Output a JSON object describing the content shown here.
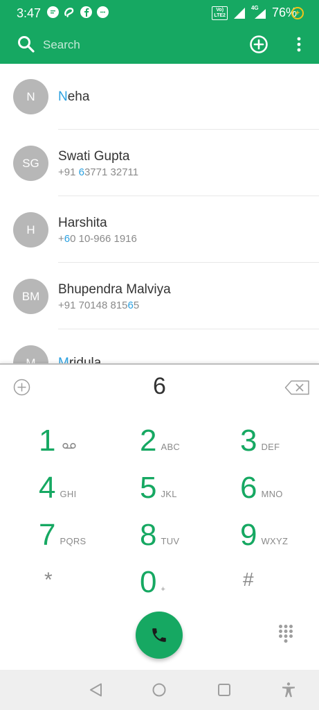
{
  "status_bar": {
    "time": "3:47",
    "network_badge_line1": "Vo)",
    "network_badge_line2": "LTE2",
    "data_type": "4G",
    "battery_percent": "76%",
    "icons": [
      "chat-bubble-icon",
      "airtel-icon",
      "facebook-icon",
      "messenger-icon",
      "volte-icon",
      "signal-icon",
      "signal-4g-icon",
      "battery-saver-icon"
    ]
  },
  "toolbar": {
    "search_placeholder": "Search",
    "icons": [
      "search-icon",
      "add-contact-icon",
      "more-vert-icon"
    ]
  },
  "contacts": [
    {
      "initials": "N",
      "name_highlight": "N",
      "name_rest": "eha",
      "phone_pre": "",
      "phone_hl": "",
      "phone_post": ""
    },
    {
      "initials": "SG",
      "name_highlight": "",
      "name_rest": "Swati Gupta",
      "phone_pre": "+91 ",
      "phone_hl": "6",
      "phone_post": "3771 32711"
    },
    {
      "initials": "H",
      "name_highlight": "",
      "name_rest": "Harshita",
      "phone_pre": "+",
      "phone_hl": "6",
      "phone_post": "0 10-966 1916"
    },
    {
      "initials": "BM",
      "name_highlight": "",
      "name_rest": "Bhupendra Malviya",
      "phone_pre": "+91 70148 815",
      "phone_hl": "6",
      "phone_post": "5"
    },
    {
      "initials": "M",
      "name_highlight": "M",
      "name_rest": "ridula",
      "phone_pre": "",
      "phone_hl": "",
      "phone_post": ""
    }
  ],
  "dialer": {
    "number": "6",
    "keys": [
      {
        "digit": "1",
        "letters": "",
        "voicemail": true
      },
      {
        "digit": "2",
        "letters": "ABC"
      },
      {
        "digit": "3",
        "letters": "DEF"
      },
      {
        "digit": "4",
        "letters": "GHI"
      },
      {
        "digit": "5",
        "letters": "JKL"
      },
      {
        "digit": "6",
        "letters": "MNO"
      },
      {
        "digit": "7",
        "letters": "PQRS"
      },
      {
        "digit": "8",
        "letters": "TUV"
      },
      {
        "digit": "9",
        "letters": "WXYZ"
      },
      {
        "digit": "*",
        "letters": ""
      },
      {
        "digit": "0",
        "letters": "+"
      },
      {
        "digit": "#",
        "letters": ""
      }
    ]
  },
  "colors": {
    "accent": "#16a862",
    "highlight": "#2aa0e0",
    "avatar": "#b7b7b7"
  }
}
